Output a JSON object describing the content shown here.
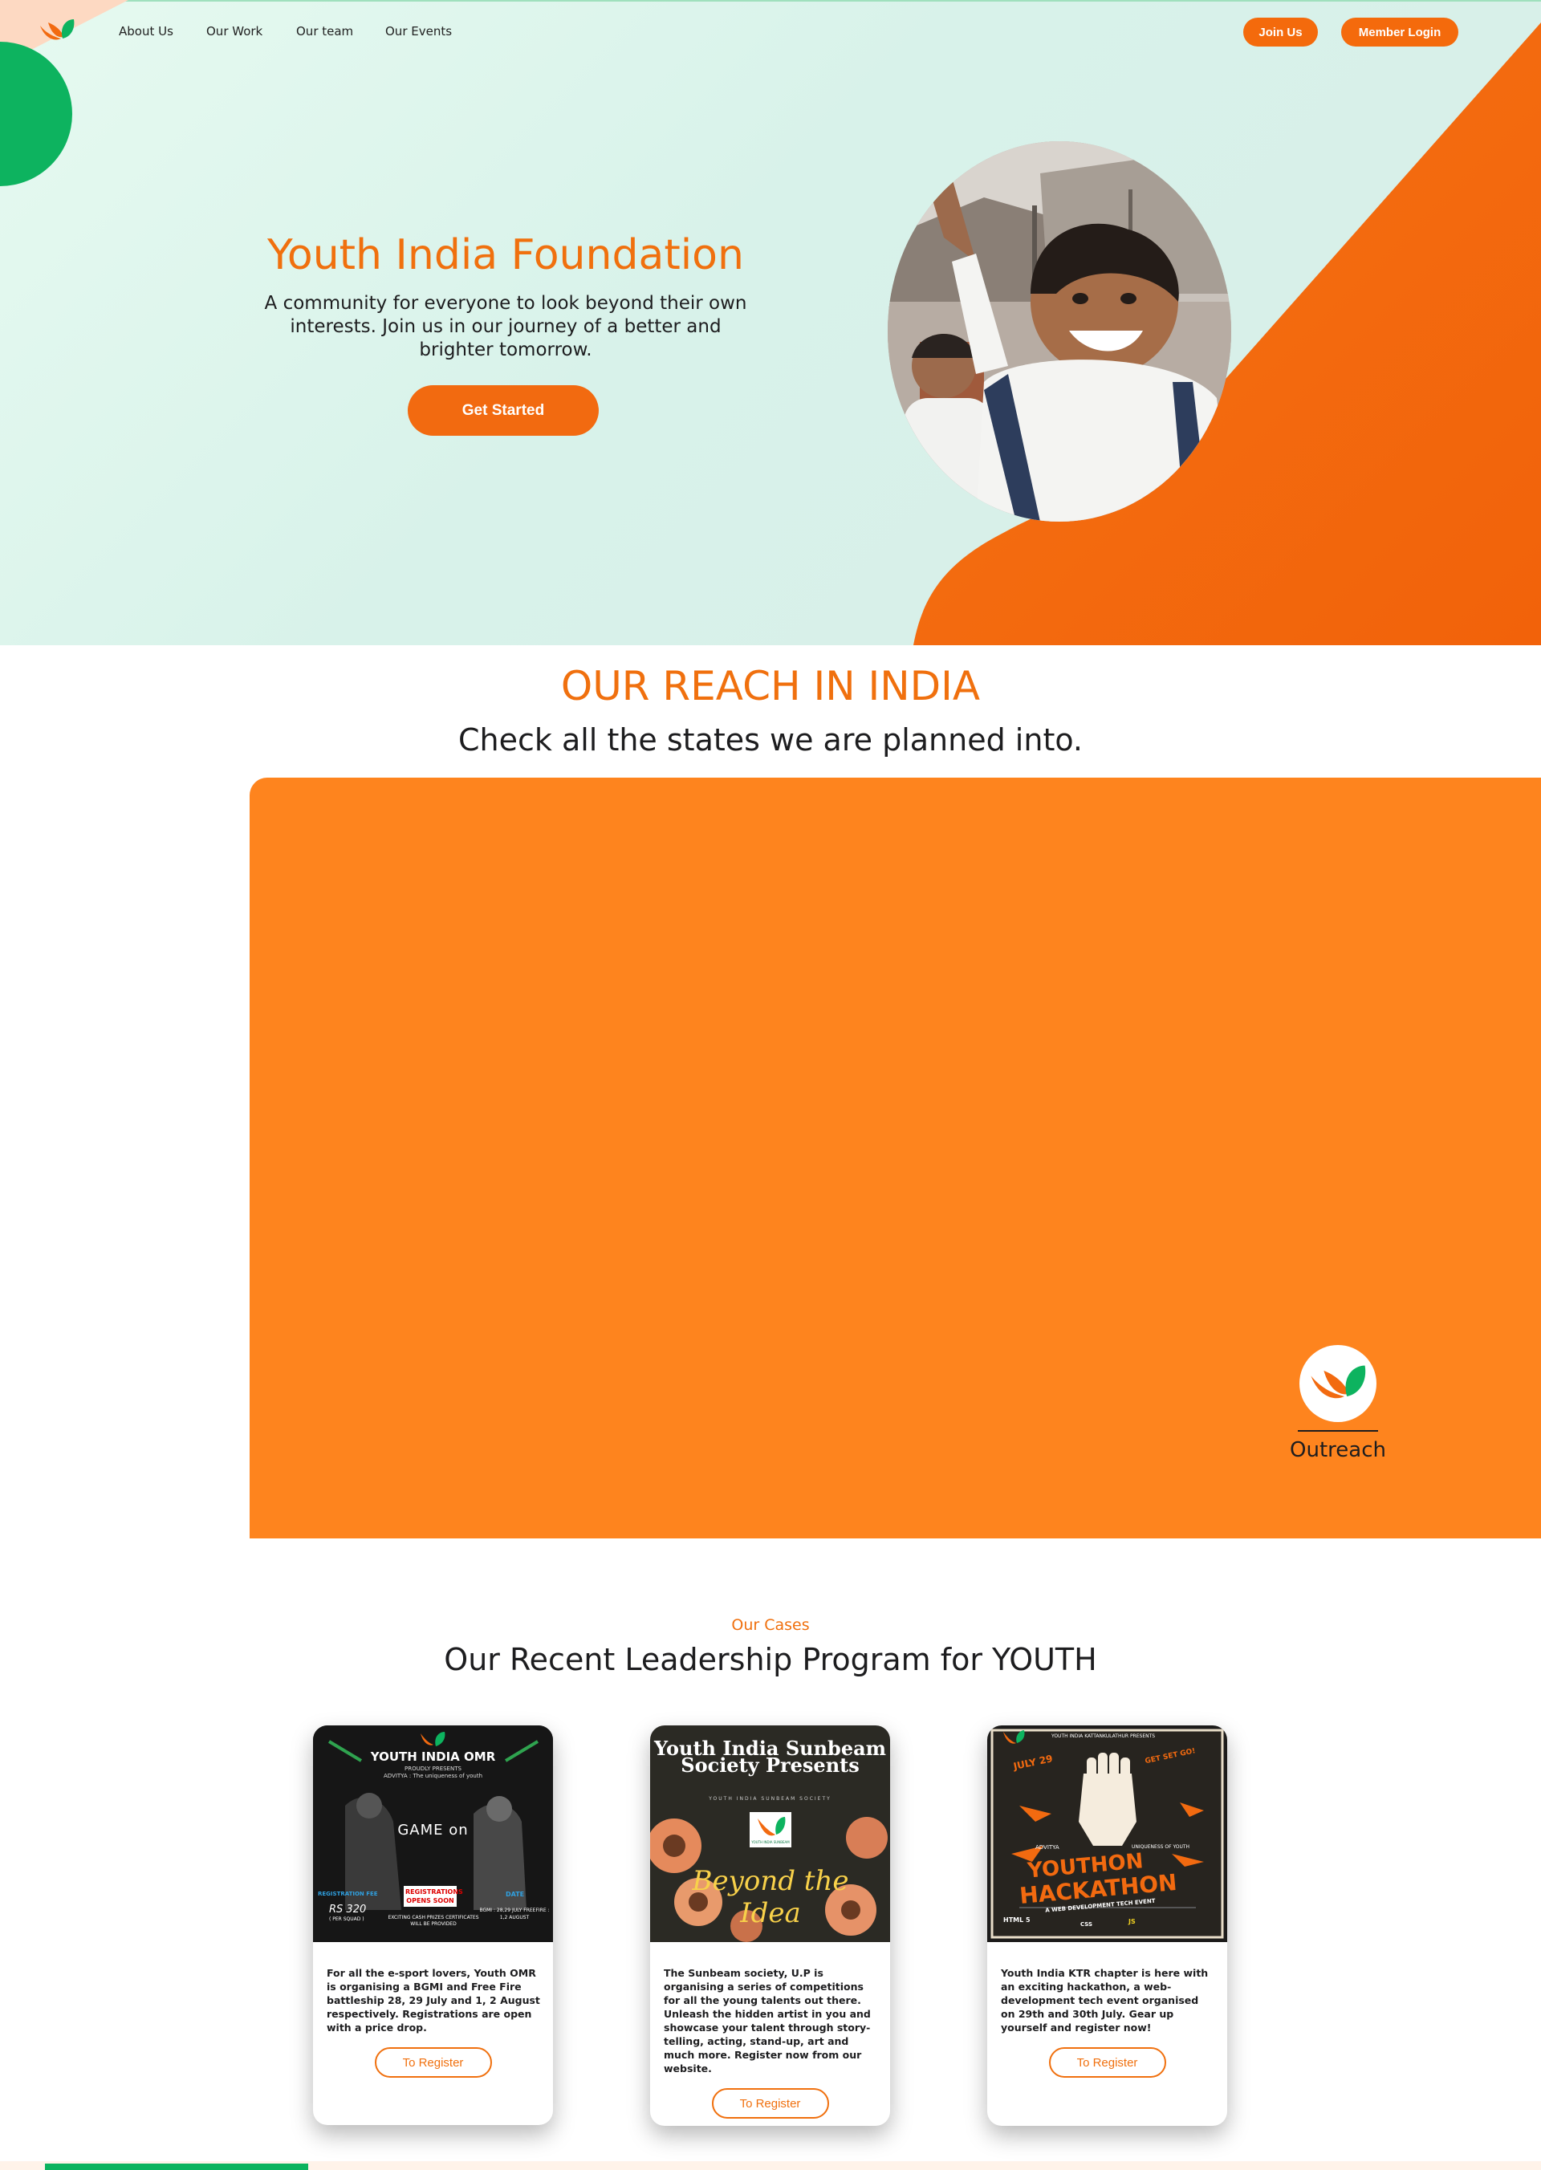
{
  "nav": {
    "links": [
      "About Us",
      "Our Work",
      "Our team",
      "Our Events"
    ],
    "join_label": "Join Us",
    "login_label": "Member Login"
  },
  "hero": {
    "title": "Youth India Foundation",
    "subtitle": "A community for everyone to look beyond their own interests. Join us in our journey of a better and brighter tomorrow.",
    "cta_label": "Get Started"
  },
  "reach": {
    "title": "OUR REACH IN INDIA",
    "subtitle": "Check all the states we are planned into.",
    "badge_label": "Outreach"
  },
  "cases": {
    "kicker": "Our Cases",
    "title": "Our Recent Leadership Program for YOUTH",
    "cards": [
      {
        "poster_title": "YOUTH INDIA OMR",
        "poster_sub1": "PROUDLY PRESENTS",
        "poster_sub2": "ADVITYA : The uniqueness of youth",
        "poster_game": "GAME on",
        "poster_fee_label": "REGISTRATION FEE",
        "poster_fee": "RS 320",
        "poster_fee_note": "( PER SQUAD )",
        "poster_badge": "REGISTRATIONS OPENS SOON",
        "poster_prizes": "EXCITING CASH PRIZES CERTIFICATES WILL BE PROVIDED",
        "poster_date_label": "DATE",
        "poster_date": "BGMI : 28,29 JULY FREEFIRE : 1,2 AUGUST",
        "text": "For all the e-sport lovers, Youth OMR is organising a BGMI and Free Fire battleship 28, 29 July and 1, 2 August respectively. Registrations are open with a price drop.",
        "button": "To Register"
      },
      {
        "poster_title": "Youth India Sunbeam Society Presents",
        "poster_sub1": "YOUTH INDIA SUNBEAM SOCIETY",
        "poster_logo_text": "YOUTH INDIA SUNBEAM",
        "poster_script": "Beyond the Idea",
        "text": "The Sunbeam society, U.P is organising a series of competitions for all the young talents out there. Unleash the hidden artist in you and showcase your talent through story-telling, acting, stand-up, art and much more. Register now from our website.",
        "button": "To Register"
      },
      {
        "poster_top": "YOUTH INDIA KATTANKULATHUR PRESENTS",
        "poster_date": "JULY 29",
        "poster_tag": "GET SET GO!",
        "poster_advitya": "ADVITYA",
        "poster_youth": "UNIQUENESS OF YOUTH",
        "poster_title1": "YOUTHON",
        "poster_title2": "HACKATHON",
        "poster_sub": "A WEB DEVELOPMENT TECH EVENT",
        "poster_tech": [
          "HTML 5",
          "CSS",
          "JS"
        ],
        "text": "Youth India KTR chapter is here with an exciting hackathon, a web-development tech event organised on 29th and 30th July. Gear up yourself and register now!",
        "button": "To Register"
      }
    ]
  },
  "colors": {
    "brand_orange": "#f26a10",
    "panel_orange": "#fe841e",
    "brand_green": "#0db35f"
  },
  "icons": [
    "brand-logo-icon",
    "outreach-logo-icon"
  ]
}
